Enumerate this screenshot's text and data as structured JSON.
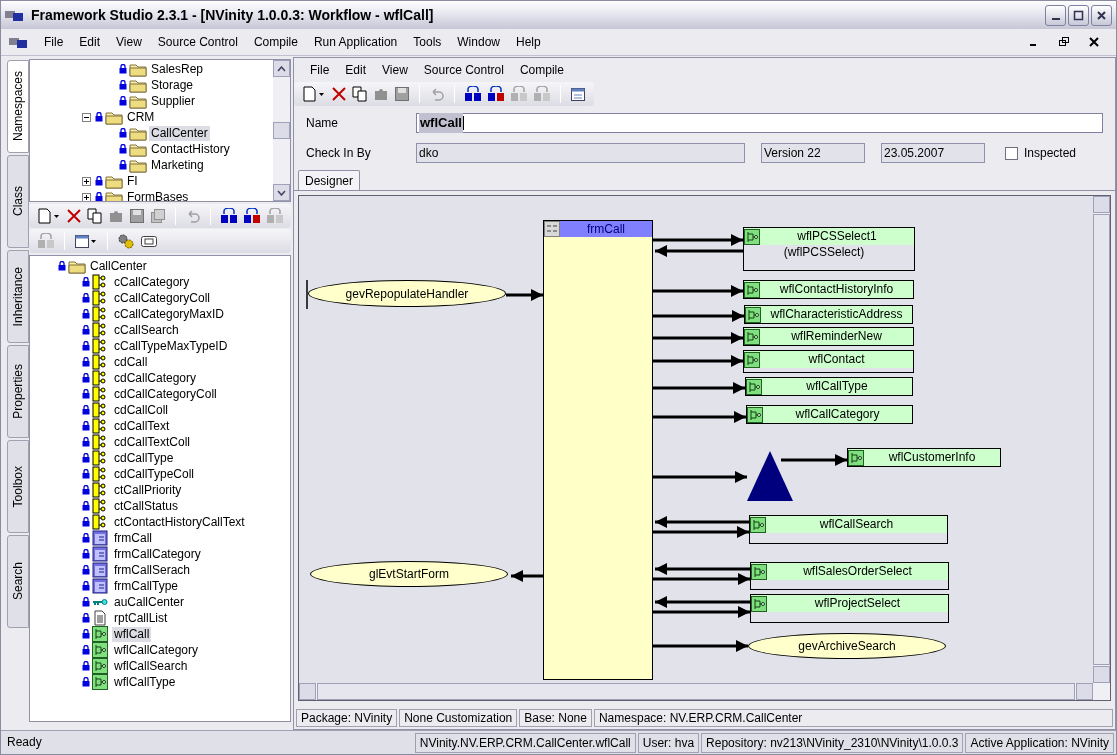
{
  "window": {
    "title": "Framework Studio 2.3.1 - [NVinity 1.0.0.3: Workflow - wflCall]"
  },
  "menu": [
    "File",
    "Edit",
    "View",
    "Source Control",
    "Compile",
    "Run Application",
    "Tools",
    "Window",
    "Help"
  ],
  "side_tabs": [
    {
      "label": "Namespaces",
      "selected": true
    },
    {
      "label": "Class",
      "selected": false
    },
    {
      "label": "Inheritance",
      "selected": false
    },
    {
      "label": "Properties",
      "selected": false
    },
    {
      "label": "Toolbox",
      "selected": false
    },
    {
      "label": "Search",
      "selected": false
    }
  ],
  "namespace_tree": [
    {
      "children": [
        {
          "label": "SalesRep",
          "selected": false
        },
        {
          "label": "Storage",
          "selected": false
        },
        {
          "label": "Supplier",
          "selected": false
        }
      ]
    },
    {
      "label": "CRM",
      "expanded": true,
      "selected": false,
      "children": [
        {
          "label": "CallCenter",
          "selected": true
        },
        {
          "label": "ContactHistory",
          "selected": false
        },
        {
          "label": "Marketing",
          "selected": false
        }
      ]
    },
    {
      "label": "FI",
      "expanded": false,
      "selected": false
    },
    {
      "label": "FormBases",
      "expanded": false,
      "selected": false
    }
  ],
  "class_tree": {
    "label": "CallCenter",
    "children": [
      {
        "label": "cCallCategory",
        "kind": "class",
        "selected": false
      },
      {
        "label": "cCallCategoryColl",
        "kind": "class",
        "selected": false
      },
      {
        "label": "cCallCategoryMaxID",
        "kind": "class",
        "selected": false
      },
      {
        "label": "cCallSearch",
        "kind": "class",
        "selected": false
      },
      {
        "label": "cCallTypeMaxTypeID",
        "kind": "class",
        "selected": false
      },
      {
        "label": "cdCall",
        "kind": "class",
        "selected": false
      },
      {
        "label": "cdCallCategory",
        "kind": "class",
        "selected": false
      },
      {
        "label": "cdCallCategoryColl",
        "kind": "class",
        "selected": false
      },
      {
        "label": "cdCallColl",
        "kind": "class",
        "selected": false
      },
      {
        "label": "cdCallText",
        "kind": "class",
        "selected": false
      },
      {
        "label": "cdCallTextColl",
        "kind": "class",
        "selected": false
      },
      {
        "label": "cdCallType",
        "kind": "class",
        "selected": false
      },
      {
        "label": "cdCallTypeColl",
        "kind": "class",
        "selected": false
      },
      {
        "label": "ctCallPriority",
        "kind": "class",
        "selected": false
      },
      {
        "label": "ctCallStatus",
        "kind": "class",
        "selected": false
      },
      {
        "label": "ctContactHistoryCallText",
        "kind": "class",
        "selected": false
      },
      {
        "label": "frmCall",
        "kind": "form",
        "selected": false
      },
      {
        "label": "frmCallCategory",
        "kind": "form",
        "selected": false
      },
      {
        "label": "frmCallSerach",
        "kind": "form",
        "selected": false
      },
      {
        "label": "frmCallType",
        "kind": "form",
        "selected": false
      },
      {
        "label": "auCallCenter",
        "kind": "key",
        "selected": false
      },
      {
        "label": "rptCallList",
        "kind": "report",
        "selected": false
      },
      {
        "label": "wflCall",
        "kind": "workflow",
        "selected": true
      },
      {
        "label": "wflCallCategory",
        "kind": "workflow",
        "selected": false
      },
      {
        "label": "wflCallSearch",
        "kind": "workflow",
        "selected": false
      },
      {
        "label": "wflCallType",
        "kind": "workflow",
        "selected": false
      }
    ]
  },
  "editor": {
    "menu": [
      "File",
      "Edit",
      "View",
      "Source Control",
      "Compile"
    ],
    "name_label": "Name",
    "name_value": "wflCall",
    "checkin_label": "Check In By",
    "checkin_value": "dko",
    "version": "Version 22",
    "date": "23.05.2007",
    "inspected": {
      "label": "Inspected",
      "checked": false
    },
    "tabs": [
      {
        "label": "Designer",
        "selected": true
      }
    ]
  },
  "designer": {
    "nodes": [
      {
        "kind": "form",
        "label": "frmCall"
      },
      {
        "kind": "event",
        "label": "gevRepopulateHandler"
      },
      {
        "kind": "event",
        "label": "glEvtStartForm"
      },
      {
        "kind": "workflow",
        "label": "wflPCSSelect1",
        "subtitle": "(wflPCSSelect)"
      },
      {
        "kind": "workflow",
        "label": "wflContactHistoryInfo"
      },
      {
        "kind": "workflow",
        "label": "wflCharacteristicAddress"
      },
      {
        "kind": "workflow",
        "label": "wflReminderNew"
      },
      {
        "kind": "workflow",
        "label": "wflContact"
      },
      {
        "kind": "workflow",
        "label": "wflCallType"
      },
      {
        "kind": "workflow",
        "label": "wflCallCategory"
      },
      {
        "kind": "decision"
      },
      {
        "kind": "workflow",
        "label": "wflCustomerInfo"
      },
      {
        "kind": "workflow",
        "label": "wflCallSearch"
      },
      {
        "kind": "workflow",
        "label": "wflSalesOrderSelect"
      },
      {
        "kind": "workflow",
        "label": "wflProjectSelect"
      },
      {
        "kind": "event",
        "label": "gevArchiveSearch"
      }
    ]
  },
  "editor_status": [
    "Package: NVinity",
    "None Customization",
    "Base: None",
    "Namespace: NV.ERP.CRM.CallCenter"
  ],
  "status_bar": [
    "Ready",
    "NVinity.NV.ERP.CRM.CallCenter.wflCall",
    "User: hva",
    "Repository: nv213\\NVinity_2310\\NVinity\\1.0.0.3",
    "Active Application: NVinity"
  ]
}
